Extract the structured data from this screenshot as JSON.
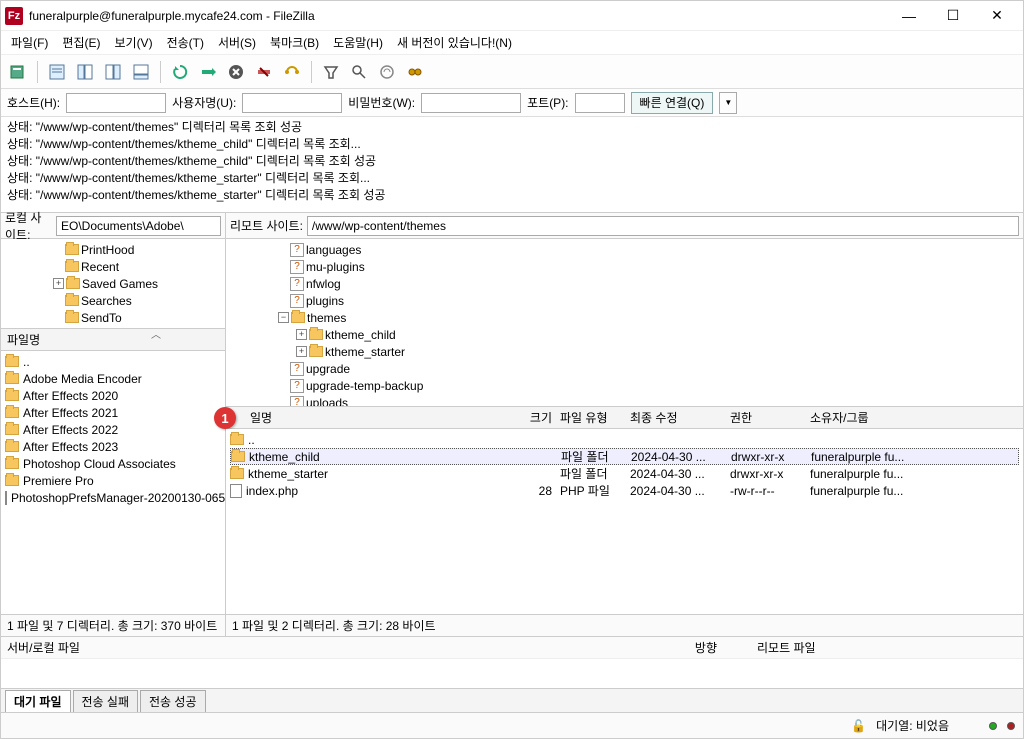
{
  "window": {
    "title": "funeralpurple@funeralpurple.mycafe24.com - FileZilla"
  },
  "menu": [
    "파일(F)",
    "편집(E)",
    "보기(V)",
    "전송(T)",
    "서버(S)",
    "북마크(B)",
    "도움말(H)",
    "새 버전이 있습니다!(N)"
  ],
  "conn": {
    "host_label": "호스트(H):",
    "user_label": "사용자명(U):",
    "pass_label": "비밀번호(W):",
    "port_label": "포트(P):",
    "connect_btn": "빠른 연결(Q)"
  },
  "log": [
    "상태:  \"/www/wp-content/themes\" 디렉터리 목록 조회 성공",
    "상태:  \"/www/wp-content/themes/ktheme_child\" 디렉터리 목록 조회...",
    "상태:  \"/www/wp-content/themes/ktheme_child\" 디렉터리 목록 조회 성공",
    "상태:  \"/www/wp-content/themes/ktheme_starter\" 디렉터리 목록 조회...",
    "상태:  \"/www/wp-content/themes/ktheme_starter\" 디렉터리 목록 조회 성공"
  ],
  "local": {
    "label": "로컬 사이트:",
    "path": "EO\\Documents\\Adobe\\",
    "tree": [
      "PrintHood",
      "Recent",
      "Saved Games",
      "Searches",
      "SendTo"
    ],
    "list_hdr": "파일명",
    "files": [
      "..",
      "Adobe Media Encoder",
      "After Effects 2020",
      "After Effects 2021",
      "After Effects 2022",
      "After Effects 2023",
      "Photoshop Cloud Associates",
      "Premiere Pro",
      "PhotoshopPrefsManager-20200130-065"
    ],
    "status": "1 파일 및 7 디렉터리. 총 크기: 370 바이트"
  },
  "remote": {
    "label": "리모트 사이트:",
    "path": "/www/wp-content/themes",
    "tree": [
      {
        "name": "languages",
        "icon": "q"
      },
      {
        "name": "mu-plugins",
        "icon": "q"
      },
      {
        "name": "nfwlog",
        "icon": "q"
      },
      {
        "name": "plugins",
        "icon": "q"
      },
      {
        "name": "themes",
        "icon": "f",
        "expanded": true,
        "children": [
          {
            "name": "ktheme_child",
            "icon": "f",
            "exp": "+"
          },
          {
            "name": "ktheme_starter",
            "icon": "f",
            "exp": "+"
          }
        ]
      },
      {
        "name": "upgrade",
        "icon": "q"
      },
      {
        "name": "upgrade-temp-backup",
        "icon": "q"
      },
      {
        "name": "uploads",
        "icon": "q"
      }
    ],
    "headers": {
      "name": "일명",
      "size": "크기",
      "type": "파일 유형",
      "mod": "최종 수정",
      "perm": "권한",
      "own": "소유자/그룹"
    },
    "rows": [
      {
        "name": "..",
        "icon": "f"
      },
      {
        "name": "ktheme_child",
        "icon": "f",
        "size": "",
        "type": "파일 폴더",
        "mod": "2024-04-30 ...",
        "perm": "drwxr-xr-x",
        "own": "funeralpurple fu...",
        "sel": true
      },
      {
        "name": "ktheme_starter",
        "icon": "f",
        "size": "",
        "type": "파일 폴더",
        "mod": "2024-04-30 ...",
        "perm": "drwxr-xr-x",
        "own": "funeralpurple fu..."
      },
      {
        "name": "index.php",
        "icon": "file",
        "size": "28",
        "type": "PHP 파일",
        "mod": "2024-04-30 ...",
        "perm": "-rw-r--r--",
        "own": "funeralpurple fu..."
      }
    ],
    "status": "1 파일 및 2 디렉터리. 총 크기: 28 바이트",
    "badge": "1"
  },
  "queue": {
    "hdr_local": "서버/로컬 파일",
    "hdr_dir": "방향",
    "hdr_remote": "리모트 파일",
    "tabs": [
      "대기 파일",
      "전송 실패",
      "전송 성공"
    ],
    "bottom": "대기열: 비었음"
  }
}
